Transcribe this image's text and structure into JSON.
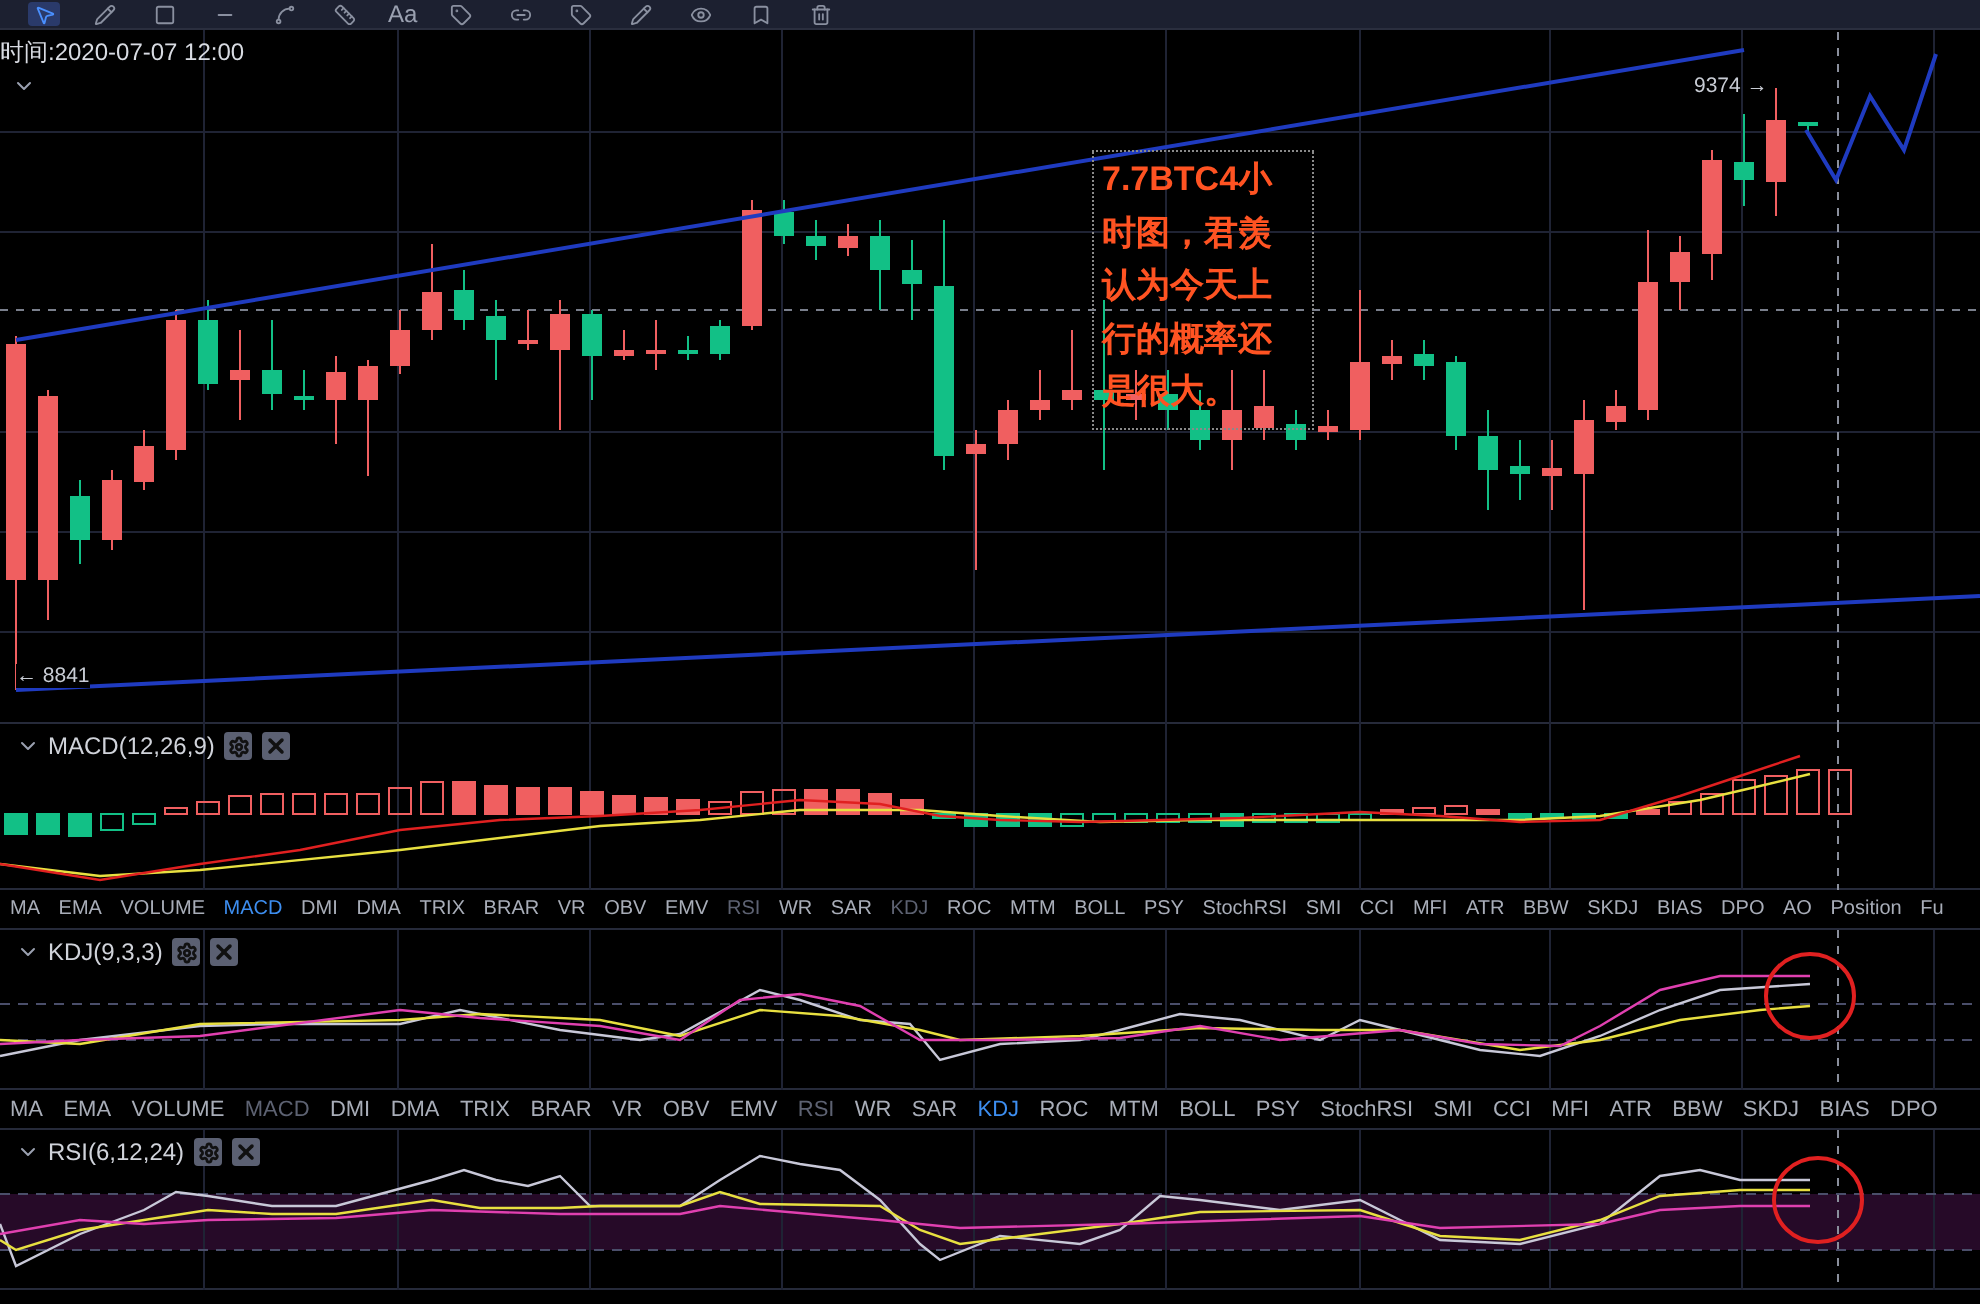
{
  "toolbar": {
    "text_tool": "Aa"
  },
  "main_chart": {
    "time_label": "时间:2020-07-07 12:00",
    "high_label": "9374 →",
    "low_label": "← 8841",
    "annotation": "7.7BTC4小时图，君羡认为今天上行的概率还是很大。"
  },
  "indicator_panes": [
    {
      "kind": "macd",
      "title": "MACD(12,26,9)",
      "tab_bar": [
        {
          "label": "MA",
          "selected": false,
          "disabled": false
        },
        {
          "label": "EMA",
          "selected": false,
          "disabled": false
        },
        {
          "label": "VOLUME",
          "selected": false,
          "disabled": false
        },
        {
          "label": "MACD",
          "selected": true,
          "disabled": false
        },
        {
          "label": "DMI",
          "selected": false,
          "disabled": false
        },
        {
          "label": "DMA",
          "selected": false,
          "disabled": false
        },
        {
          "label": "TRIX",
          "selected": false,
          "disabled": false
        },
        {
          "label": "BRAR",
          "selected": false,
          "disabled": false
        },
        {
          "label": "VR",
          "selected": false,
          "disabled": false
        },
        {
          "label": "OBV",
          "selected": false,
          "disabled": false
        },
        {
          "label": "EMV",
          "selected": false,
          "disabled": false
        },
        {
          "label": "RSI",
          "selected": false,
          "disabled": true
        },
        {
          "label": "WR",
          "selected": false,
          "disabled": false
        },
        {
          "label": "SAR",
          "selected": false,
          "disabled": false
        },
        {
          "label": "KDJ",
          "selected": false,
          "disabled": true
        },
        {
          "label": "ROC",
          "selected": false,
          "disabled": false
        },
        {
          "label": "MTM",
          "selected": false,
          "disabled": false
        },
        {
          "label": "BOLL",
          "selected": false,
          "disabled": false
        },
        {
          "label": "PSY",
          "selected": false,
          "disabled": false
        },
        {
          "label": "StochRSI",
          "selected": false,
          "disabled": false
        },
        {
          "label": "SMI",
          "selected": false,
          "disabled": false
        },
        {
          "label": "CCI",
          "selected": false,
          "disabled": false
        },
        {
          "label": "MFI",
          "selected": false,
          "disabled": false
        },
        {
          "label": "ATR",
          "selected": false,
          "disabled": false
        },
        {
          "label": "BBW",
          "selected": false,
          "disabled": false
        },
        {
          "label": "SKDJ",
          "selected": false,
          "disabled": false
        },
        {
          "label": "BIAS",
          "selected": false,
          "disabled": false
        },
        {
          "label": "DPO",
          "selected": false,
          "disabled": false
        },
        {
          "label": "AO",
          "selected": false,
          "disabled": false
        },
        {
          "label": "Position",
          "selected": false,
          "disabled": false
        },
        {
          "label": "Fu",
          "selected": false,
          "disabled": false
        }
      ]
    },
    {
      "kind": "kdj",
      "title": "KDJ(9,3,3)",
      "tab_bar": [
        {
          "label": "MA",
          "selected": false,
          "disabled": false
        },
        {
          "label": "EMA",
          "selected": false,
          "disabled": false
        },
        {
          "label": "VOLUME",
          "selected": false,
          "disabled": false
        },
        {
          "label": "MACD",
          "selected": false,
          "disabled": true
        },
        {
          "label": "DMI",
          "selected": false,
          "disabled": false
        },
        {
          "label": "DMA",
          "selected": false,
          "disabled": false
        },
        {
          "label": "TRIX",
          "selected": false,
          "disabled": false
        },
        {
          "label": "BRAR",
          "selected": false,
          "disabled": false
        },
        {
          "label": "VR",
          "selected": false,
          "disabled": false
        },
        {
          "label": "OBV",
          "selected": false,
          "disabled": false
        },
        {
          "label": "EMV",
          "selected": false,
          "disabled": false
        },
        {
          "label": "RSI",
          "selected": false,
          "disabled": true
        },
        {
          "label": "WR",
          "selected": false,
          "disabled": false
        },
        {
          "label": "SAR",
          "selected": false,
          "disabled": false
        },
        {
          "label": "KDJ",
          "selected": true,
          "disabled": false
        },
        {
          "label": "ROC",
          "selected": false,
          "disabled": false
        },
        {
          "label": "MTM",
          "selected": false,
          "disabled": false
        },
        {
          "label": "BOLL",
          "selected": false,
          "disabled": false
        },
        {
          "label": "PSY",
          "selected": false,
          "disabled": false
        },
        {
          "label": "StochRSI",
          "selected": false,
          "disabled": false
        },
        {
          "label": "SMI",
          "selected": false,
          "disabled": false
        },
        {
          "label": "CCI",
          "selected": false,
          "disabled": false
        },
        {
          "label": "MFI",
          "selected": false,
          "disabled": false
        },
        {
          "label": "ATR",
          "selected": false,
          "disabled": false
        },
        {
          "label": "BBW",
          "selected": false,
          "disabled": false
        },
        {
          "label": "SKDJ",
          "selected": false,
          "disabled": false
        },
        {
          "label": "BIAS",
          "selected": false,
          "disabled": false
        },
        {
          "label": "DPO",
          "selected": false,
          "disabled": false
        }
      ]
    },
    {
      "kind": "rsi",
      "title": "RSI(6,12,24)"
    }
  ]
}
